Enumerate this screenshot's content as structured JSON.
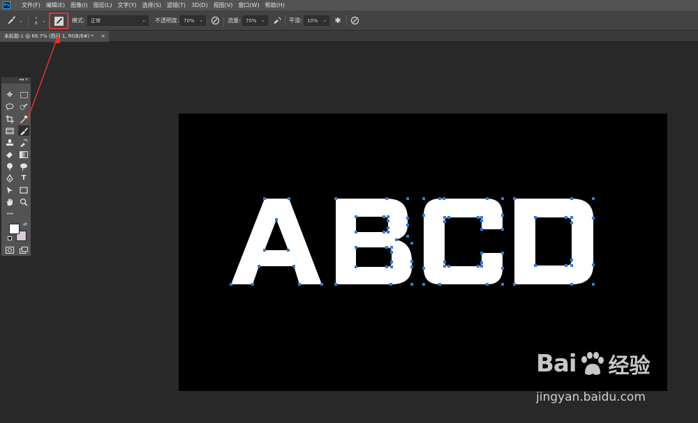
{
  "app": {
    "logo_text": "Ps"
  },
  "menu": [
    "文件(F)",
    "编辑(E)",
    "图像(I)",
    "图层(L)",
    "文字(Y)",
    "选择(S)",
    "滤镜(T)",
    "3D(D)",
    "视图(V)",
    "窗口(W)",
    "帮助(H)"
  ],
  "options": {
    "brush_size": "6",
    "mode_label": "模式:",
    "mode_value": "正常",
    "opacity_label": "不透明度:",
    "opacity_value": "70%",
    "flow_label": "流量:",
    "flow_value": "70%",
    "smoothing_label": "平滑:",
    "smoothing_value": "10%"
  },
  "document": {
    "tab_title": "未标题-1 @ 66.7% (图层 1, RGB/8#) *",
    "close": "×"
  },
  "toolbox": {
    "collapse": "◂◂",
    "close": "×",
    "more": "•••"
  },
  "canvas": {
    "text": "ABCD",
    "background": "#000000",
    "text_color": "#ffffff",
    "anchor_color": "#2f7bd6"
  },
  "watermark": {
    "brand_left": "Bai",
    "brand_right": "经验",
    "url": "jingyan.baidu.com"
  },
  "annotation": {
    "color": "#e5322d"
  }
}
